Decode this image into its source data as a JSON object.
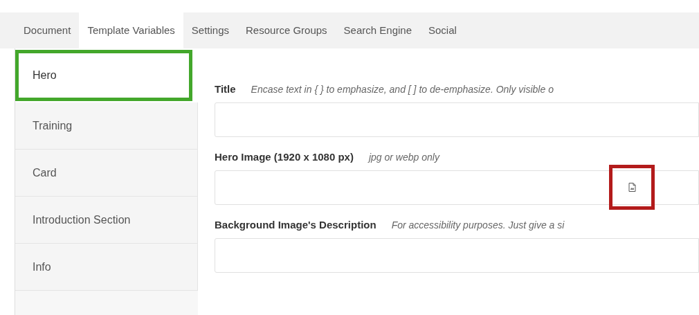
{
  "tabs": [
    {
      "label": "Document",
      "selected": false
    },
    {
      "label": "Template Variables",
      "selected": true
    },
    {
      "label": "Settings",
      "selected": false
    },
    {
      "label": "Resource Groups",
      "selected": false
    },
    {
      "label": "Search Engine",
      "selected": false
    },
    {
      "label": "Social",
      "selected": false
    }
  ],
  "sidebar": {
    "items": [
      {
        "label": "Hero",
        "selected": true,
        "highlighted": true
      },
      {
        "label": "Training",
        "selected": false,
        "highlighted": false
      },
      {
        "label": "Card",
        "selected": false,
        "highlighted": false
      },
      {
        "label": "Introduction Section",
        "selected": false,
        "highlighted": false
      },
      {
        "label": "Info",
        "selected": false,
        "highlighted": false
      }
    ]
  },
  "fields": [
    {
      "label": "Title",
      "hint": "Encase text in { } to emphasize, and [ ] to de-emphasize. Only visible o",
      "kind": "text"
    },
    {
      "label": "Hero Image (1920 x 1080 px)",
      "hint": "jpg or webp only",
      "kind": "image",
      "button_highlighted": true
    },
    {
      "label": "Background Image's Description",
      "hint": "For accessibility purposes. Just give a si",
      "kind": "text"
    }
  ]
}
